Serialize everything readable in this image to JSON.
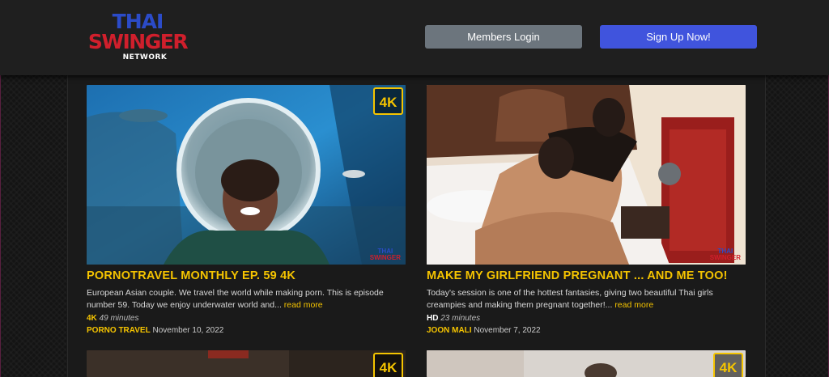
{
  "logo": {
    "line1": "THAI",
    "line2": "SWINGER",
    "line3": "NETWORK"
  },
  "header": {
    "login_label": "Members Login",
    "signup_label": "Sign Up Now!"
  },
  "videos": [
    {
      "badge": "4K",
      "title": "PORNOTRAVEL MONTHLY EP. 59 4K",
      "description": "European Asian couple. We travel the world while making porn. This is episode number 59. Today we enjoy underwater world and...",
      "read_more": "read more",
      "quality": "4K",
      "duration": "49 minutes",
      "model": "PORNO TRAVEL",
      "date": "November 10, 2022",
      "watermark_1": "THAI",
      "watermark_2": "SWINGER"
    },
    {
      "badge": "",
      "title": "MAKE MY GIRLFRIEND PREGNANT ... AND ME TOO!",
      "description": "Today's session is one of the hottest fantasies, giving two beautiful Thai girls creampies and making them pregnant together!...",
      "read_more": "read more",
      "quality": "HD",
      "duration": "23 minutes",
      "model": "JOON MALI",
      "date": "November 7, 2022",
      "watermark_1": "THAI",
      "watermark_2": "SWINGER"
    },
    {
      "badge": "4K"
    },
    {
      "badge": "4K"
    }
  ],
  "colors": {
    "accent": "#f5c400",
    "signup": "#4054dd",
    "login": "#6c757d",
    "logo_blue": "#2b4bc8",
    "logo_red": "#d01f2c"
  }
}
